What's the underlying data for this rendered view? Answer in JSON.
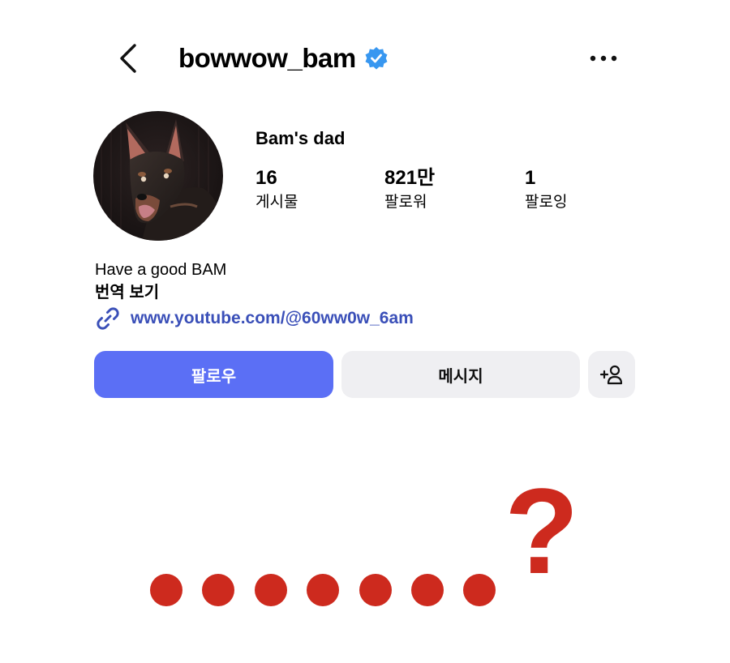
{
  "header": {
    "back_icon": "chevron-left-icon",
    "username": "bowwow_bam",
    "verified_icon": "verified-badge-icon",
    "verified_color": "#3897f0",
    "more_icon": "more-horizontal-icon"
  },
  "profile": {
    "avatar_icon": "doberman-photo",
    "display_name": "Bam's dad",
    "stats": [
      {
        "value": "16",
        "label": "게시물"
      },
      {
        "value": "821만",
        "label": "팔로워"
      },
      {
        "value": "1",
        "label": "팔로잉"
      }
    ],
    "bio": "Have a good BAM",
    "translate_label": "번역 보기",
    "link_icon": "link-icon",
    "link": "www.youtube.com/@60ww0w_6am"
  },
  "actions": {
    "follow_label": "팔로우",
    "message_label": "메시지",
    "add_user_icon": "add-user-icon",
    "follow_color": "#5b6ff5"
  },
  "overlay": {
    "question_mark": "?",
    "dot_count": 7,
    "color": "#cd2a1e"
  }
}
